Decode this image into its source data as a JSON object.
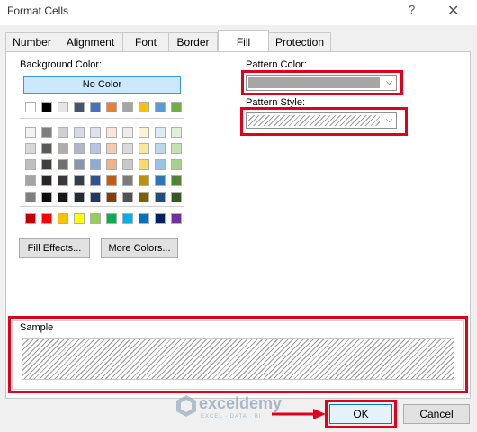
{
  "window": {
    "title": "Format Cells",
    "help_glyph": "?",
    "close_glyph": "✕"
  },
  "tabs": [
    {
      "label": "Number",
      "active": false
    },
    {
      "label": "Alignment",
      "active": false
    },
    {
      "label": "Font",
      "active": false
    },
    {
      "label": "Border",
      "active": false
    },
    {
      "label": "Fill",
      "active": true
    },
    {
      "label": "Protection",
      "active": false
    }
  ],
  "background": {
    "label": "Background Color:",
    "no_color_label": "No Color",
    "theme_top_row": [
      "#ffffff",
      "#000000",
      "#e7e6e6",
      "#44546a",
      "#4472c4",
      "#ed7d31",
      "#a5a5a5",
      "#ffc000",
      "#5b9bd5",
      "#70ad47"
    ],
    "theme_shades": [
      [
        "#f2f2f2",
        "#7f7f7f",
        "#d0cece",
        "#d6dce4",
        "#d9e2f3",
        "#fbe5d5",
        "#ededed",
        "#fff2cc",
        "#deebf6",
        "#e2efd9"
      ],
      [
        "#d8d8d8",
        "#595959",
        "#aeabab",
        "#adb9ca",
        "#b4c6e7",
        "#f7caac",
        "#dbdbdb",
        "#fee599",
        "#bdd7ee",
        "#c5e0b3"
      ],
      [
        "#bfbfbf",
        "#3f3f3f",
        "#757070",
        "#8496b0",
        "#8eaadb",
        "#f4b183",
        "#c9c9c9",
        "#ffd965",
        "#9cc3e5",
        "#a8d08d"
      ],
      [
        "#a5a5a5",
        "#262626",
        "#3a3838",
        "#323f4f",
        "#2f5496",
        "#c55a11",
        "#7b7b7b",
        "#bf9000",
        "#2e75b5",
        "#538135"
      ],
      [
        "#7f7f7f",
        "#0c0c0c",
        "#171616",
        "#222a35",
        "#1f3864",
        "#833c0b",
        "#525252",
        "#7f6000",
        "#1e4e79",
        "#375623"
      ]
    ],
    "standard_colors": [
      "#c00000",
      "#ff0000",
      "#ffc000",
      "#ffff00",
      "#92d050",
      "#00b050",
      "#00b0f0",
      "#0070c0",
      "#002060",
      "#7030a0"
    ],
    "fill_effects_label": "Fill Effects...",
    "more_colors_label": "More Colors..."
  },
  "pattern": {
    "color_label": "Pattern Color:",
    "color_value": "#a6a6a6",
    "style_label": "Pattern Style:"
  },
  "sample": {
    "label": "Sample"
  },
  "watermark": {
    "name": "exceldemy",
    "tagline": "EXCEL · DATA · BI"
  },
  "footer": {
    "ok_label": "OK",
    "cancel_label": "Cancel"
  },
  "colors": {
    "highlight_red": "#e0001b",
    "selection_blue": "#cce8ff"
  }
}
